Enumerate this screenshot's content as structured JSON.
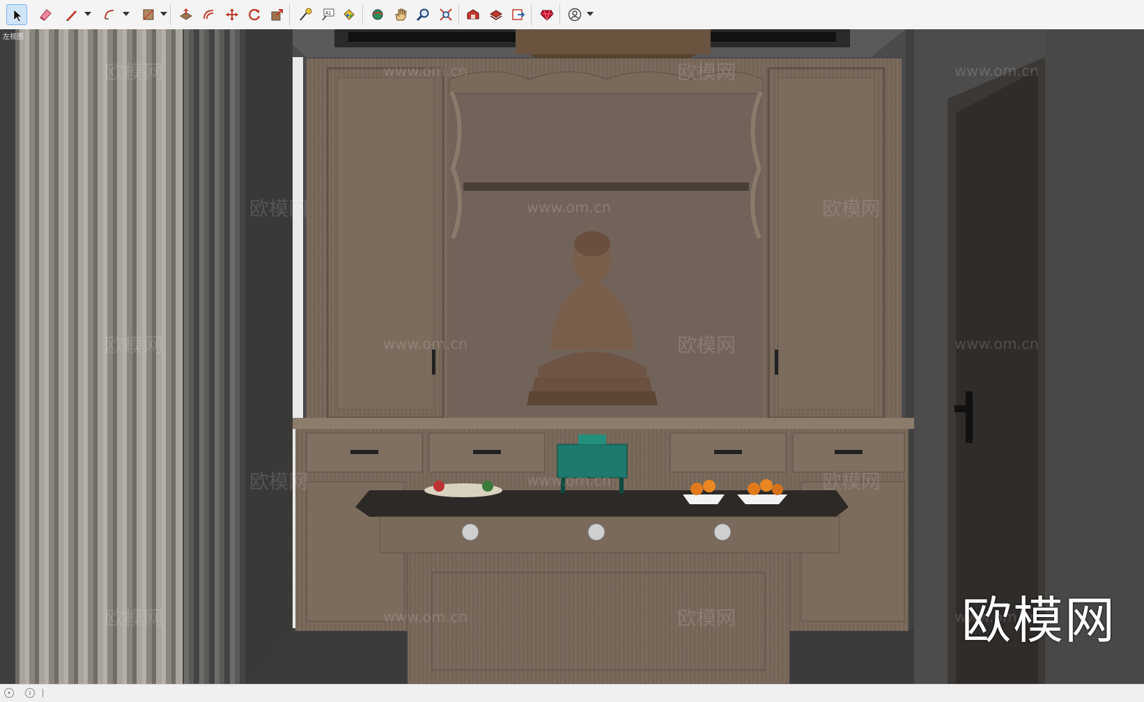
{
  "app": {
    "name": "SketchUp"
  },
  "toolbar": {
    "tools": [
      {
        "name": "select-tool",
        "icon": "arrow-cursor-icon",
        "active": true
      },
      {
        "name": "eraser-tool",
        "icon": "eraser-icon"
      },
      {
        "name": "pencil-tool",
        "icon": "pencil-icon",
        "dropdown": true
      },
      {
        "name": "arc-tool",
        "icon": "arc-icon",
        "dropdown": true
      },
      {
        "name": "rectangle-tool",
        "icon": "rectangle-icon",
        "dropdown": true
      },
      {
        "name": "push-pull-tool",
        "icon": "push-pull-icon"
      },
      {
        "name": "offset-tool",
        "icon": "offset-icon"
      },
      {
        "name": "move-tool",
        "icon": "move-icon"
      },
      {
        "name": "rotate-tool",
        "icon": "rotate-icon"
      },
      {
        "name": "scale-tool",
        "icon": "scale-icon"
      },
      {
        "name": "tape-measure-tool",
        "icon": "tape-measure-icon"
      },
      {
        "name": "text-tool",
        "icon": "text-icon",
        "label": "A1"
      },
      {
        "name": "paint-bucket-tool",
        "icon": "paint-bucket-icon"
      },
      {
        "name": "orbit-tool",
        "icon": "orbit-icon"
      },
      {
        "name": "pan-tool",
        "icon": "hand-icon"
      },
      {
        "name": "zoom-tool",
        "icon": "magnifier-icon"
      },
      {
        "name": "zoom-extents-tool",
        "icon": "zoom-extents-icon"
      },
      {
        "name": "warehouse-tool",
        "icon": "warehouse-icon"
      },
      {
        "name": "extension-warehouse-tool",
        "icon": "extension-warehouse-icon"
      },
      {
        "name": "layout-send-tool",
        "icon": "layout-icon"
      },
      {
        "name": "ruby-console-tool",
        "icon": "ruby-gem-icon"
      },
      {
        "name": "account-tool",
        "icon": "user-account-icon",
        "dropdown": true
      }
    ],
    "text_icon_label": "A1"
  },
  "viewport": {
    "scene_label": "左视图",
    "watermark_cn": "欧模网",
    "watermark_url": "www.om.cn",
    "brand_text": "欧模网",
    "colors": {
      "wall": "#4a4a4a",
      "wood": "#7d6e60",
      "wood_dark": "#5e5246",
      "door": "#3a3634",
      "curtain_light": "#a49e96",
      "curtain_dark": "#5a5855",
      "buddha": "#7a5e4c",
      "censer": "#1d7a6c",
      "fruit": "#e27a1c"
    }
  },
  "statusbar": {
    "icons": [
      "geo-location-icon",
      "info-icon"
    ]
  }
}
